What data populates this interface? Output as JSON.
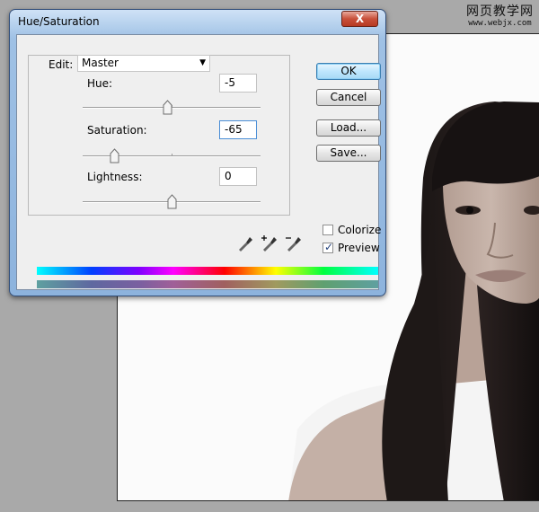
{
  "watermark": {
    "text": "网页教学网",
    "url": "www.webjx.com"
  },
  "dialog": {
    "title": "Hue/Saturation",
    "close_label": "X",
    "edit": {
      "label": "Edit:",
      "selected": "Master"
    },
    "hue": {
      "label": "Hue:",
      "value": "-5",
      "slider_min": -180,
      "slider_max": 180
    },
    "saturation": {
      "label": "Saturation:",
      "value": "-65",
      "slider_min": -100,
      "slider_max": 100
    },
    "lightness": {
      "label": "Lightness:",
      "value": "0",
      "slider_min": -100,
      "slider_max": 100
    },
    "buttons": {
      "ok": "OK",
      "cancel": "Cancel",
      "load": "Load...",
      "save": "Save..."
    },
    "colorize": {
      "label": "Colorize",
      "checked": false
    },
    "preview": {
      "label": "Preview",
      "checked": true
    },
    "icons": [
      "eyedropper-icon",
      "eyedropper-plus-icon",
      "eyedropper-minus-icon"
    ]
  },
  "colors": {
    "accent": "#3c7fb1",
    "title_bar": "#9fc1e5",
    "close_button": "#c8503a"
  }
}
